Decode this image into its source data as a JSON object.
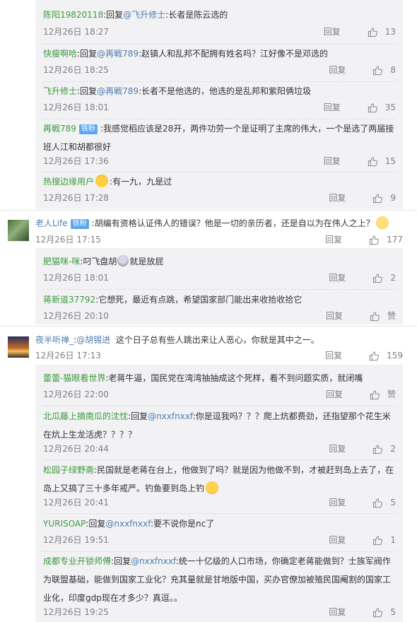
{
  "ui": {
    "reply_label": "回复",
    "reply_prefix": "回复",
    "colon": ":",
    "at": "@"
  },
  "g1": {
    "replies": [
      {
        "user": "陈阳19820118",
        "to": "飞升修士",
        "text": "长者是陈云选的",
        "date": "12月26日 18:27",
        "likes": "13"
      },
      {
        "user": "快瘦啊哈",
        "to": "再戦789",
        "text": "赵镇人和乱邦不配拥有姓名吗？江好像不是邓选的",
        "date": "12月26日 18:25",
        "likes": "8"
      },
      {
        "user": "飞升修士",
        "to": "再戦789",
        "text": "长者不是他选的，他选的是乱邦和紫阳俩垃圾",
        "date": "12月26日 18:01",
        "likes": "35"
      },
      {
        "user": "再戦789",
        "badge": "铁粉",
        "text": "我感觉稻应该是28开，两件功劳一个是证明了主席的伟大，一个是选了两届接班人江和胡都很好",
        "date": "12月26日 17:36",
        "likes": "15"
      },
      {
        "user": "热搜边缘用户",
        "text": "有一九，九是过",
        "date": "12月26日 17:28",
        "likes": "9"
      }
    ]
  },
  "c2": {
    "user": "老人Life",
    "badge": "铁粉",
    "text": "胡编有资格认证伟人的错误？他是一切的亲历者，还是自以为在伟人之上？",
    "date": "12月26日 17:15",
    "likes": "177",
    "replies": [
      {
        "user": "肥猫咪-咪",
        "text_a": "叼飞盘胡",
        "text_b": "就是放屁",
        "date": "12月26日 18:01",
        "likes": "2"
      },
      {
        "user": "蒋新道37792",
        "text": "它想死，最近有点跳，希望国家部门能出来收拾收拾它",
        "date": "12月26日 20:10",
        "likes": "赞"
      }
    ]
  },
  "c3": {
    "user": "夜半听禅_",
    "to": "胡锡进",
    "text": "这个日子总有些人跳出来让人恶心，你就是其中之一。",
    "date": "12月26日 17:13",
    "likes": "159",
    "replies": [
      {
        "user": "蕾蕾-猫眼看世界",
        "text": "老蒋牛逼，国民党在湾湾抽抽成这个死样，看不到问题实质，就闭嘴",
        "date": "12月26日 22:00",
        "likes": "赞"
      },
      {
        "user": "北瓜藤上摘南瓜的沈忱",
        "to": "nxxfnxxf",
        "text": "你是逗我吗？？？爬上炕都费劲，还指望那个花生米在炕上生龙活虎？？？？",
        "date": "12月26日 20:44",
        "likes": "2"
      },
      {
        "user": "松园子绿野斋",
        "text": "民国就是老蒋在台上，他做到了吗？就是因为他做不到，才被赶到岛上去了，在岛上又搞了三十多年戒严。钓鱼要到岛上钓",
        "date": "12月26日 20:41",
        "likes": "5"
      },
      {
        "user": "YURISOAP",
        "to": "nxxfnxxf",
        "text": "要不说你是nc了",
        "date": "12月26日 19:51",
        "likes": "1"
      },
      {
        "user": "成都专业开锁师傅",
        "to": "nxxfnxxf",
        "text": "统一十亿级的人口市场，你确定老蒋能做到？士族军阀作为联盟基础，能做到国家工业化？充其量就是甘地版中国，买办官僚加被殖民国阉割的国家工业化，印度gdp现在才多少？真逗。。",
        "date": "12月26日 19:25",
        "likes": "5"
      }
    ]
  },
  "colors": {
    "username_green": "#3c9a3c",
    "link_blue": "#507daf",
    "meta_gray": "#808080",
    "sub_bg": "#f2f2f5",
    "badge_blue": "#5ba7f1"
  },
  "icons": {
    "like": "thumbs-up-icon"
  }
}
